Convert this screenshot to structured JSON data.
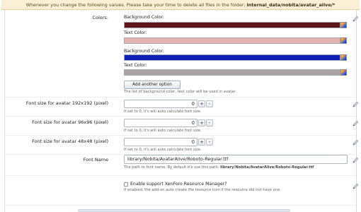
{
  "notice": {
    "text": "Whenever you change the following values. Please take your time to delete all files in the folder: ",
    "path": "internal_data/nobita/avatar_alive/*"
  },
  "colors": {
    "label": "Colors:",
    "entries": [
      {
        "label": "Background Color:",
        "value": "#5e1416"
      },
      {
        "label": "Text Color:",
        "value": "#e6b3b3"
      },
      {
        "label": "Background Color:",
        "value": "#0f1fb8"
      },
      {
        "label": "Text Color:",
        "value": "#a9a3a3"
      }
    ],
    "add_button": "Add another option",
    "hint": "The list of background color, text color will be used in avatar."
  },
  "font_sizes": [
    {
      "label": "Font size for avatar 192x192 (pixel)",
      "value": "0",
      "hint": "If set to 0, it's will auto calculate font size."
    },
    {
      "label": "Font size for avatar 96x96 (pixel)",
      "value": "0",
      "hint": "If set to 0, it's will auto calculate font size."
    },
    {
      "label": "Font size for avatar 48x48 (pixel)",
      "value": "0",
      "hint": "If set to 0, it's will auto calculate font size."
    }
  ],
  "stepper": {
    "plus": "+",
    "minus": "-"
  },
  "font_name": {
    "label": "Font Name",
    "value": "library/Nobita/AvatarAlive/Roboto-Regular.ttf",
    "hint": "The path to font name. By default it's use this path: ",
    "hint_path": "library/Nobita/AvatarAlive/Roboto-Regular.ttf"
  },
  "xenforo": {
    "label": "Enable support XenForo Resource Manager?",
    "checked": false,
    "hint": "If enabled, the add-on auto create the resource icon if the resource did not have one."
  },
  "icons": {
    "edit": "pencil-icon",
    "picker": "color-picker-icon"
  }
}
